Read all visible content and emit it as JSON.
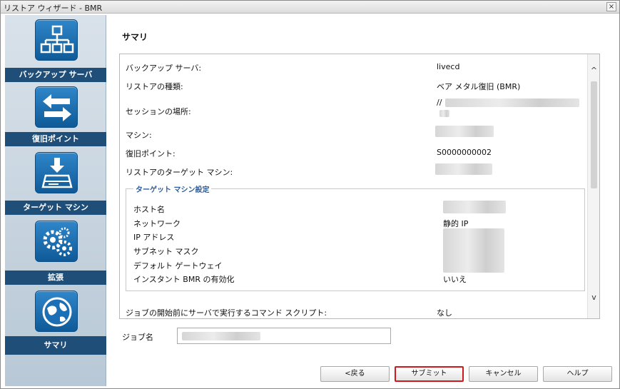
{
  "window": {
    "title": "リストア ウィザード - BMR",
    "close_glyph": "×"
  },
  "sidebar": {
    "steps": [
      {
        "label": "バックアップ サーバ",
        "icon": "network-tree-icon"
      },
      {
        "label": "復旧ポイント",
        "icon": "arrows-exchange-icon"
      },
      {
        "label": "ターゲット マシン",
        "icon": "download-drive-icon"
      },
      {
        "label": "拡張",
        "icon": "gears-icon"
      },
      {
        "label": "サマリ",
        "icon": "globe-icon"
      }
    ]
  },
  "main": {
    "title": "サマリ"
  },
  "summary": {
    "backup_server_label": "バックアップ サーバ:",
    "backup_server_value": "livecd",
    "restore_type_label": "リストアの種類:",
    "restore_type_value": "ベア メタル復旧 (BMR)",
    "session_location_label": "セッションの場所:",
    "session_location_value": "//",
    "machine_label": "マシン:",
    "recovery_point_label": "復旧ポイント:",
    "recovery_point_value": "S0000000002",
    "target_machine_label": "リストアのターゲット マシン:",
    "target_settings": {
      "legend": "ターゲット マシン設定",
      "hostname_label": "ホスト名",
      "network_label": "ネットワーク",
      "network_value": "静的 IP",
      "ip_label": "IP アドレス",
      "subnet_label": "サブネット マスク",
      "gateway_label": "デフォルト ゲートウェイ",
      "instant_bmr_label": "インスタント BMR の有効化",
      "instant_bmr_value": "いいえ"
    },
    "pre_script_label": "ジョブの開始前にサーバで実行するコマンド スクリプト:",
    "pre_script_value": "なし"
  },
  "job": {
    "label": "ジョブ名"
  },
  "buttons": {
    "back": "<戻る",
    "submit": "サブミット",
    "cancel": "キャンセル",
    "help": "ヘルプ"
  },
  "scroll": {
    "up_glyph": "^",
    "down_glyph": "v"
  }
}
